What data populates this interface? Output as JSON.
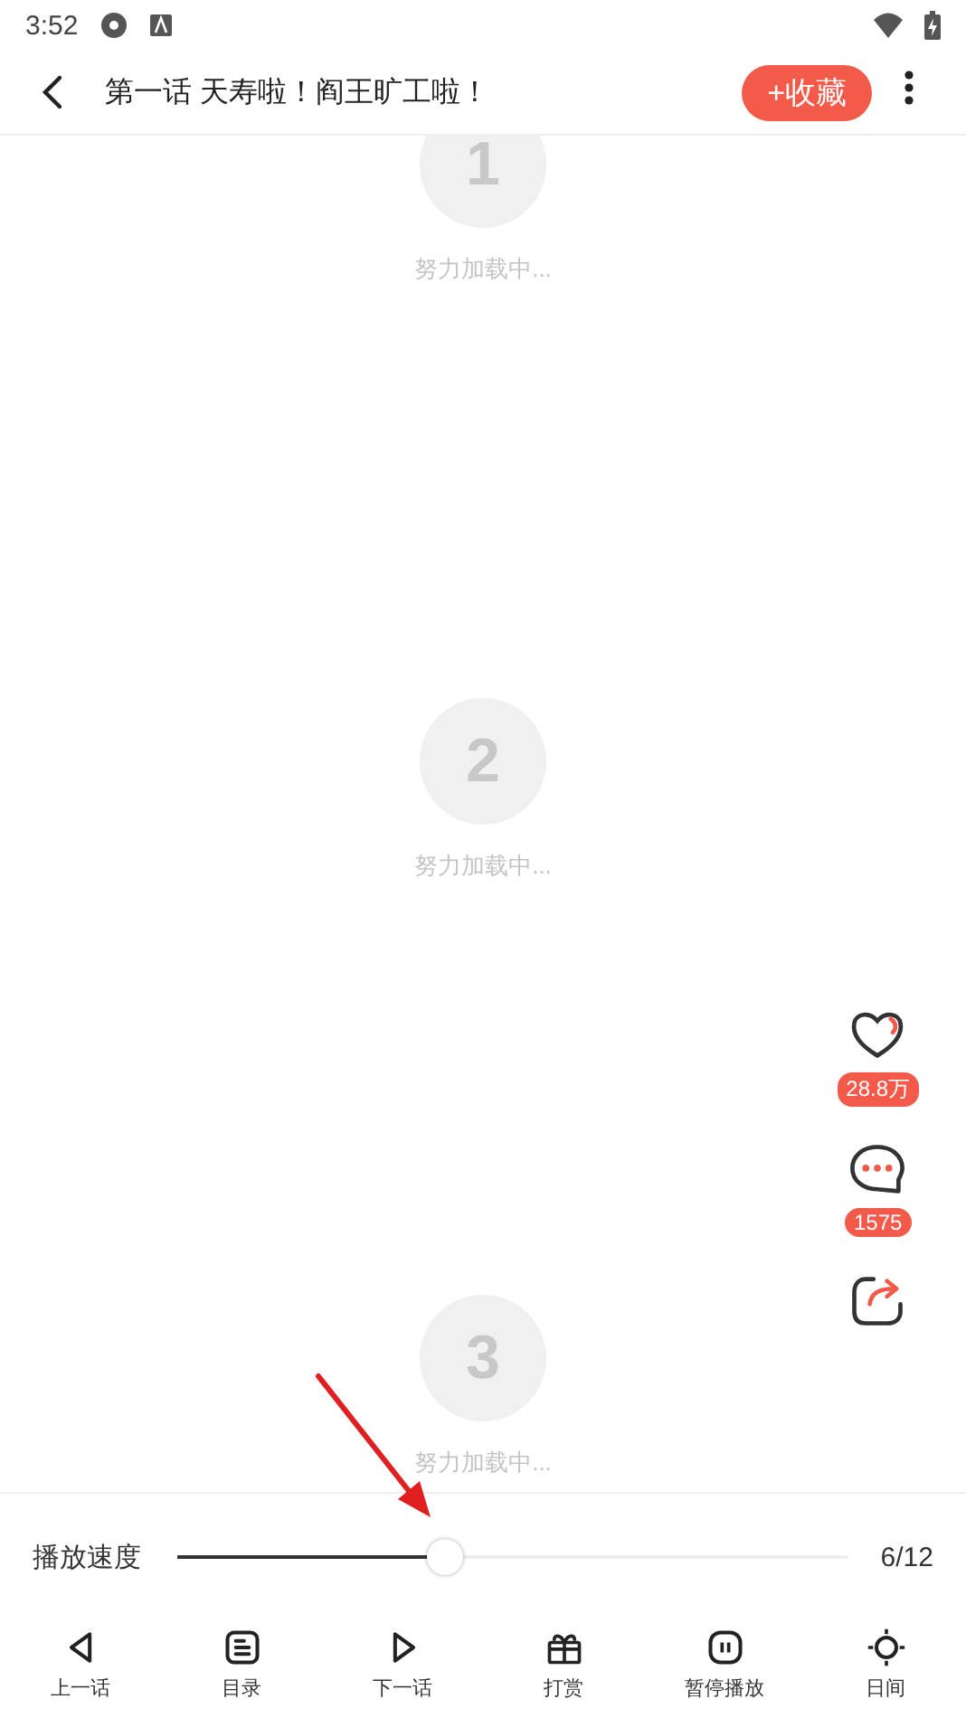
{
  "status_bar": {
    "time": "3:52"
  },
  "header": {
    "title": "第一话 天寿啦！阎王旷工啦！",
    "collect_button": "+收藏"
  },
  "pages": [
    {
      "number": "1",
      "status": "努力加载中..."
    },
    {
      "number": "2",
      "status": "努力加载中..."
    },
    {
      "number": "3",
      "status": "努力加载中..."
    }
  ],
  "side_actions": [
    {
      "kind": "like",
      "count": "28.8万"
    },
    {
      "kind": "comment",
      "count": "1575"
    },
    {
      "kind": "share"
    }
  ],
  "speed": {
    "label": "播放速度",
    "level": 0.4,
    "reading": "6/12"
  },
  "toolbar": [
    {
      "kind": "prev",
      "label": "上一话"
    },
    {
      "kind": "toc",
      "label": "目录"
    },
    {
      "kind": "next",
      "label": "下一话"
    },
    {
      "kind": "gift",
      "label": "打赏"
    },
    {
      "kind": "pause",
      "label": "暂停播放"
    },
    {
      "kind": "day",
      "label": "日间"
    }
  ]
}
